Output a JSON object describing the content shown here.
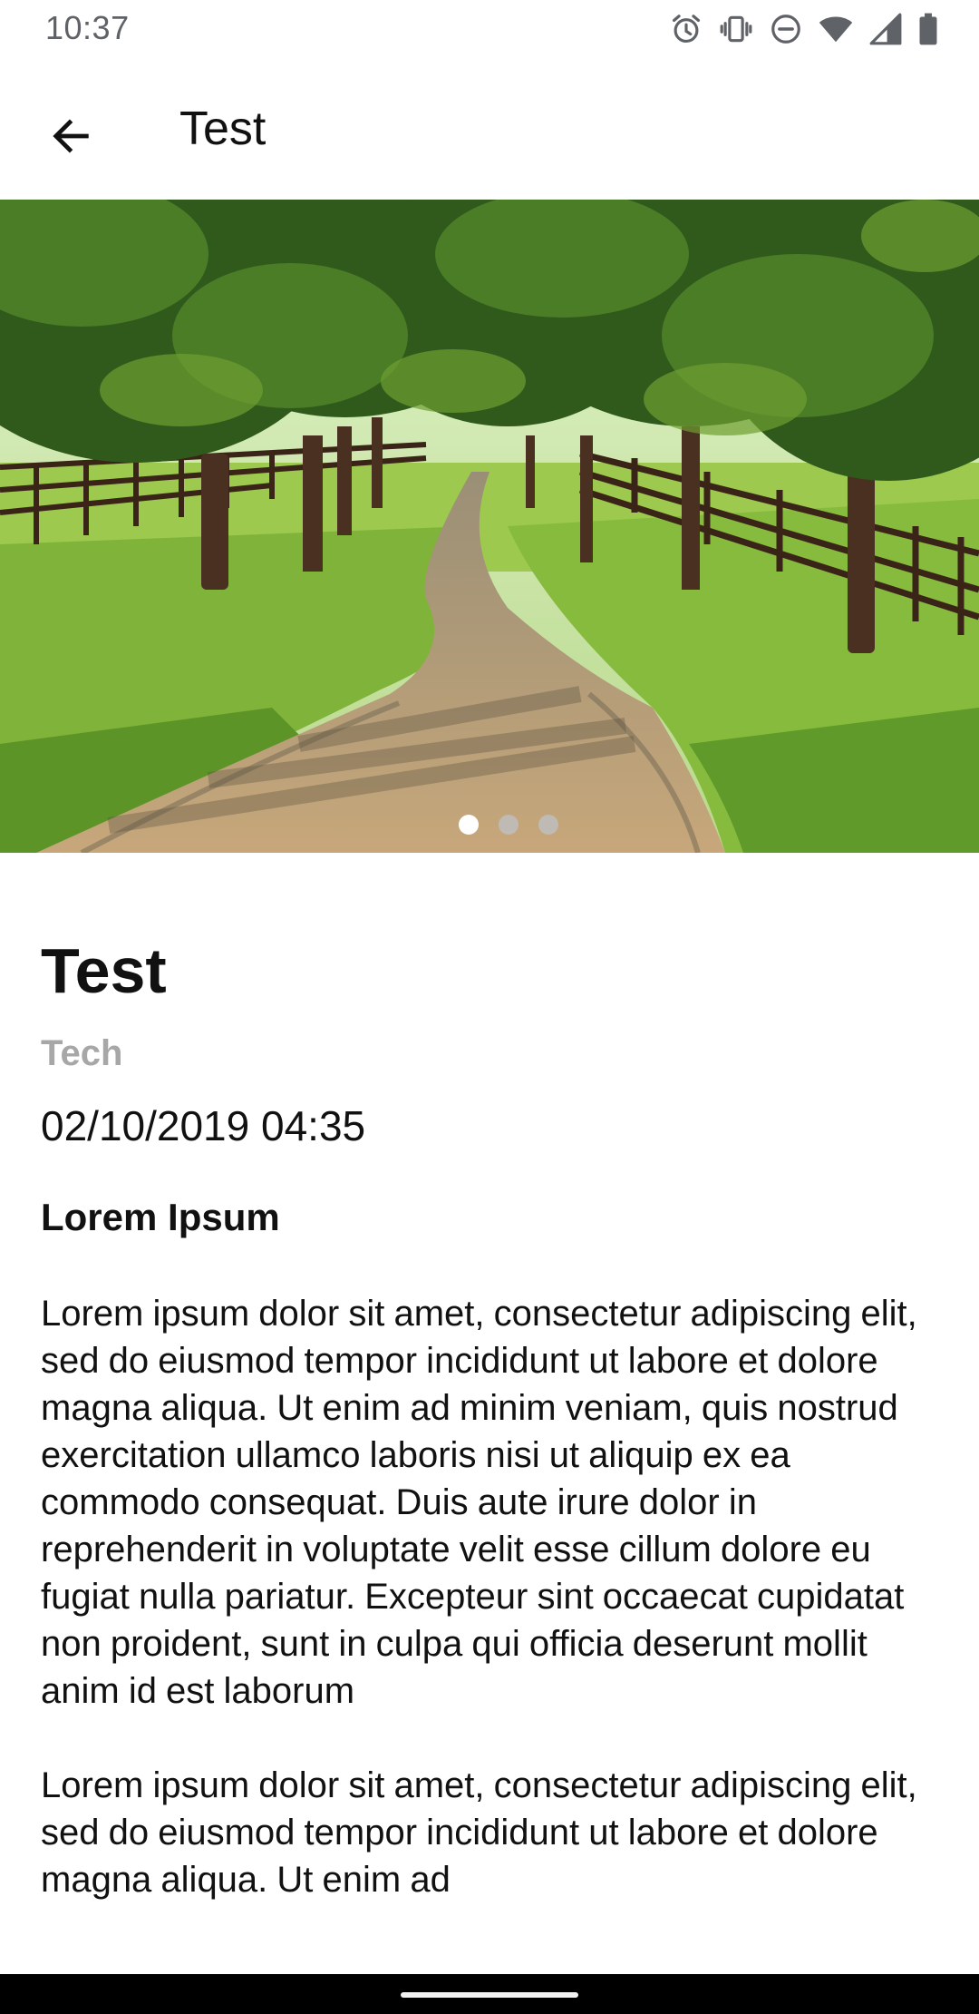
{
  "status_bar": {
    "time": "10:37",
    "icons": [
      "alarm-icon",
      "vibrate-icon",
      "do-not-disturb-icon",
      "wifi-icon",
      "signal-icon",
      "battery-icon"
    ]
  },
  "app_bar": {
    "title": "Test",
    "back_icon": "arrow-back-icon"
  },
  "carousel": {
    "image": "tree-lined-country-road-photo",
    "page_count": 3,
    "current_page": 1
  },
  "article": {
    "title": "Test",
    "category": "Tech",
    "date": "02/10/2019 04:35",
    "heading": "Lorem Ipsum",
    "paragraphs": [
      "Lorem ipsum dolor sit amet, consectetur adipiscing elit, sed do eiusmod tempor incididunt ut labore et dolore magna aliqua. Ut enim ad minim veniam, quis nostrud exercitation ullamco laboris nisi ut aliquip ex ea commodo consequat. Duis aute irure dolor in reprehenderit in voluptate velit esse cillum dolore eu fugiat nulla pariatur. Excepteur sint occaecat cupidatat non proident, sunt in culpa qui officia deserunt mollit anim id est laborum",
      "Lorem ipsum dolor sit amet, consectetur adipiscing elit, sed do eiusmod tempor incididunt ut labore et dolore magna aliqua. Ut enim ad"
    ]
  },
  "colors": {
    "category_text": "#a7a7a7",
    "status_text": "#5f6368",
    "nav_bar": "#000000"
  }
}
